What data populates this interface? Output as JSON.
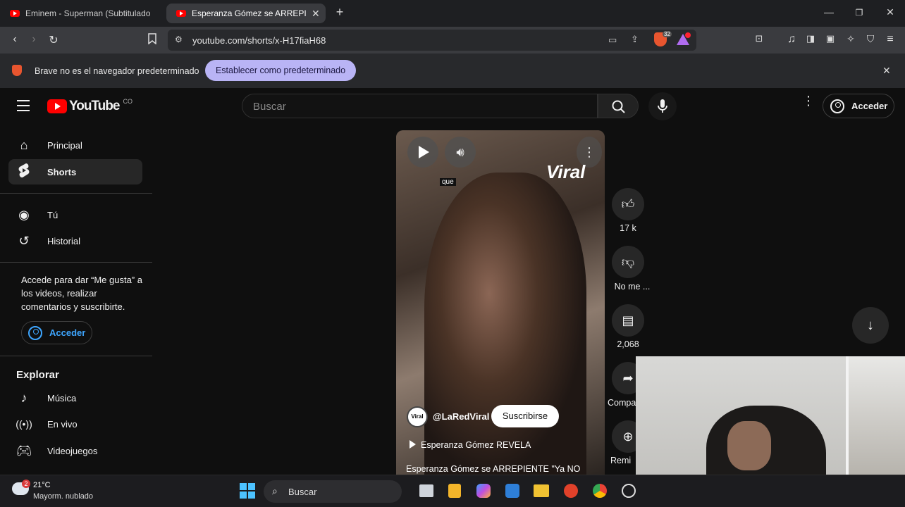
{
  "browser": {
    "tabs": [
      {
        "title": "Eminem - Superman (Subtitulado en",
        "active": false
      },
      {
        "title": "Esperanza Gómez se ARREPIENT",
        "active": true
      }
    ],
    "url": "youtube.com/shorts/x-H17fiaH68",
    "shield_badge": "32",
    "infobar_text": "Brave no es el navegador predeterminado",
    "infobar_button": "Establecer como predeterminado"
  },
  "youtube": {
    "logo_text": "YouTube",
    "country": "CO",
    "search_placeholder": "Buscar",
    "login_top": "Acceder",
    "nav": [
      {
        "label": "Principal",
        "icon": "home-icon"
      },
      {
        "label": "Shorts",
        "icon": "shorts-icon"
      }
    ],
    "you_nav": [
      {
        "label": "Tú",
        "icon": "account-icon"
      },
      {
        "label": "Historial",
        "icon": "history-icon"
      }
    ],
    "signin_prompt": "Accede para dar “Me gusta” a los videos, realizar comentarios y suscribirte.",
    "login_side": "Acceder",
    "explore_title": "Explorar",
    "explore": [
      {
        "label": "Música",
        "icon": "music-icon"
      },
      {
        "label": "En vivo",
        "icon": "live-icon"
      },
      {
        "label": "Videojuegos",
        "icon": "gaming-icon"
      }
    ]
  },
  "short": {
    "caption_word": "que",
    "watermark": "Viral",
    "channel": "@LaRedViral",
    "channel_avatar_text": "Viral",
    "subscribe": "Suscribirse",
    "playlist": "Esperanza Gómez REVELA",
    "title": "Esperanza Gómez se ARREPIENTE \"Ya NO",
    "actions": {
      "likes": "17 k",
      "dislike": "No me ...",
      "comments": "2,068",
      "share": "Compa",
      "remix": "Remi"
    }
  },
  "taskbar": {
    "weather_temp": "21°C",
    "weather_desc": "Mayorm. nublado",
    "weather_badge": "2",
    "search": "Buscar"
  }
}
